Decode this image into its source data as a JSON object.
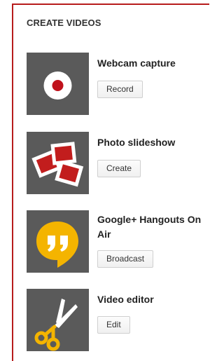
{
  "panel": {
    "heading": "CREATE VIDEOS",
    "accent_color": "#b71c1c"
  },
  "items": [
    {
      "icon": "record-icon",
      "title": "Webcam capture",
      "button_label": "Record"
    },
    {
      "icon": "photo-slideshow-icon",
      "title": "Photo slideshow",
      "button_label": "Create"
    },
    {
      "icon": "hangouts-icon",
      "title": "Google+ Hangouts On Air",
      "button_label": "Broadcast"
    },
    {
      "icon": "scissors-icon",
      "title": "Video editor",
      "button_label": "Edit"
    }
  ]
}
